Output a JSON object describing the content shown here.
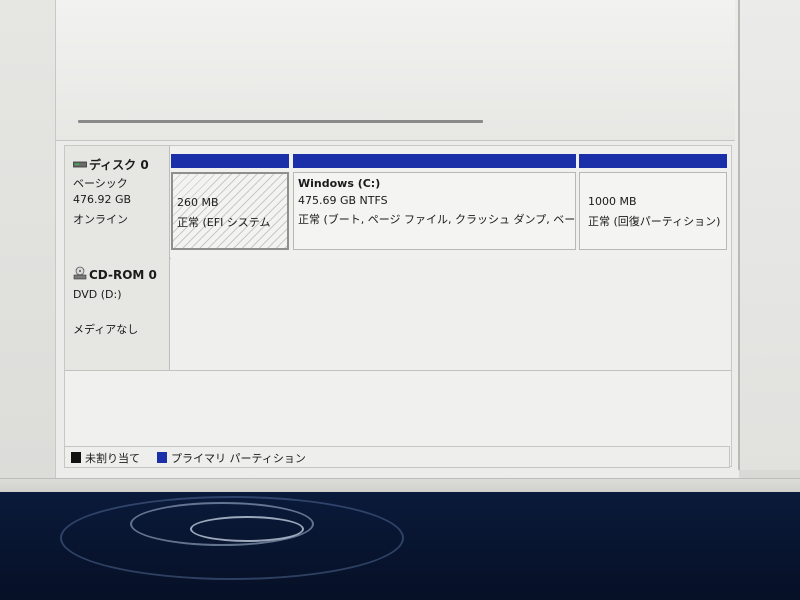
{
  "disks": [
    {
      "name": "ディスク 0",
      "type": "ベーシック",
      "size": "476.92 GB",
      "status": "オンライン",
      "icon": "hard-disk-icon",
      "partitions": [
        {
          "line1": "260 MB",
          "line2": "正常 (EFI システム",
          "hatched": true
        },
        {
          "name": "Windows  (C:)",
          "line1": "475.69 GB NTFS",
          "line2": "正常 (ブート, ページ ファイル, クラッシュ ダンプ, ベーシ"
        },
        {
          "line1": "1000 MB",
          "line2": "正常 (回復パーティション)"
        }
      ]
    },
    {
      "name": "CD-ROM 0",
      "type": "DVD (D:)",
      "status": "メディアなし",
      "icon": "cd-rom-icon"
    }
  ],
  "legend": {
    "unallocated": "未割り当て",
    "primary": "プライマリ パーティション",
    "unallocated_color": "#111111",
    "primary_color": "#1b2fa8"
  }
}
